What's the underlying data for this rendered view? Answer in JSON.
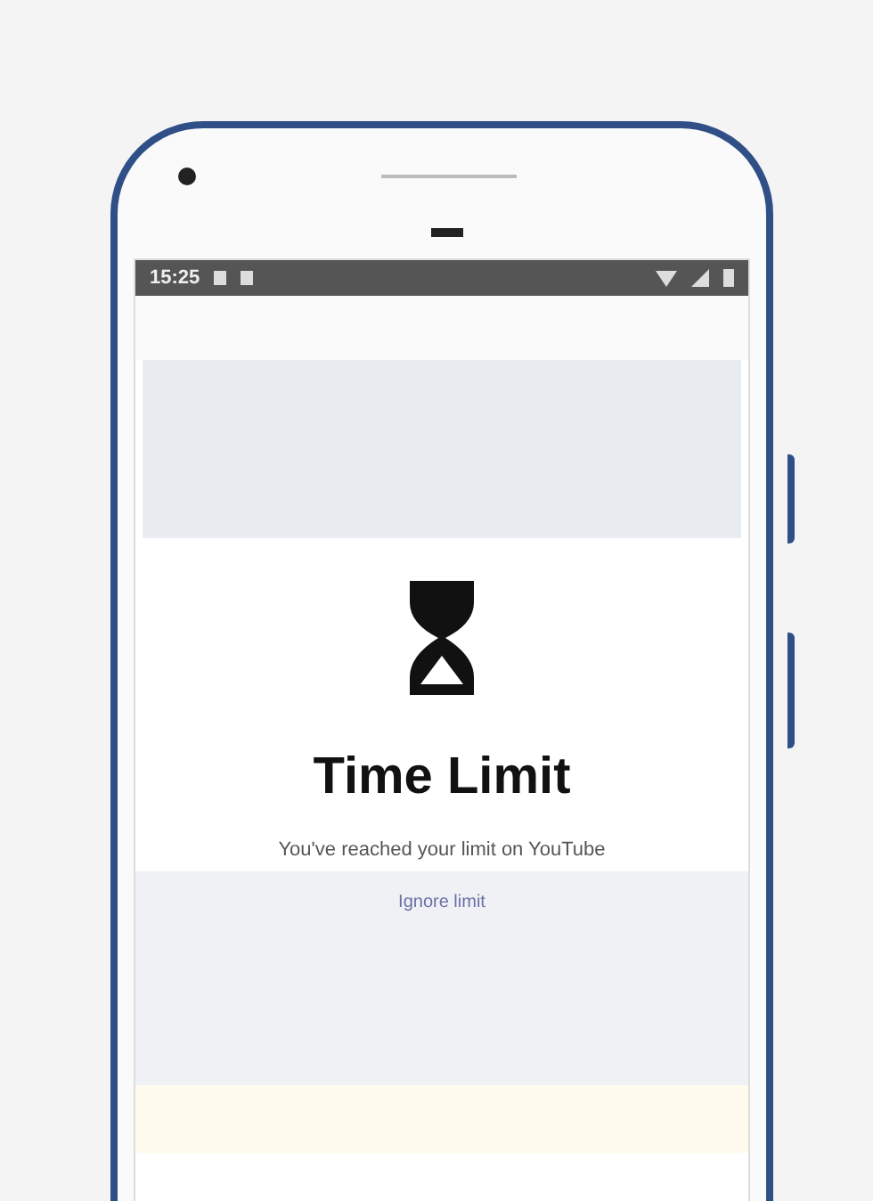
{
  "status_bar": {
    "time": "15:25"
  },
  "dialog": {
    "title": "Time Limit",
    "message": "You've reached your limit on YouTube",
    "link": "Ignore limit"
  }
}
